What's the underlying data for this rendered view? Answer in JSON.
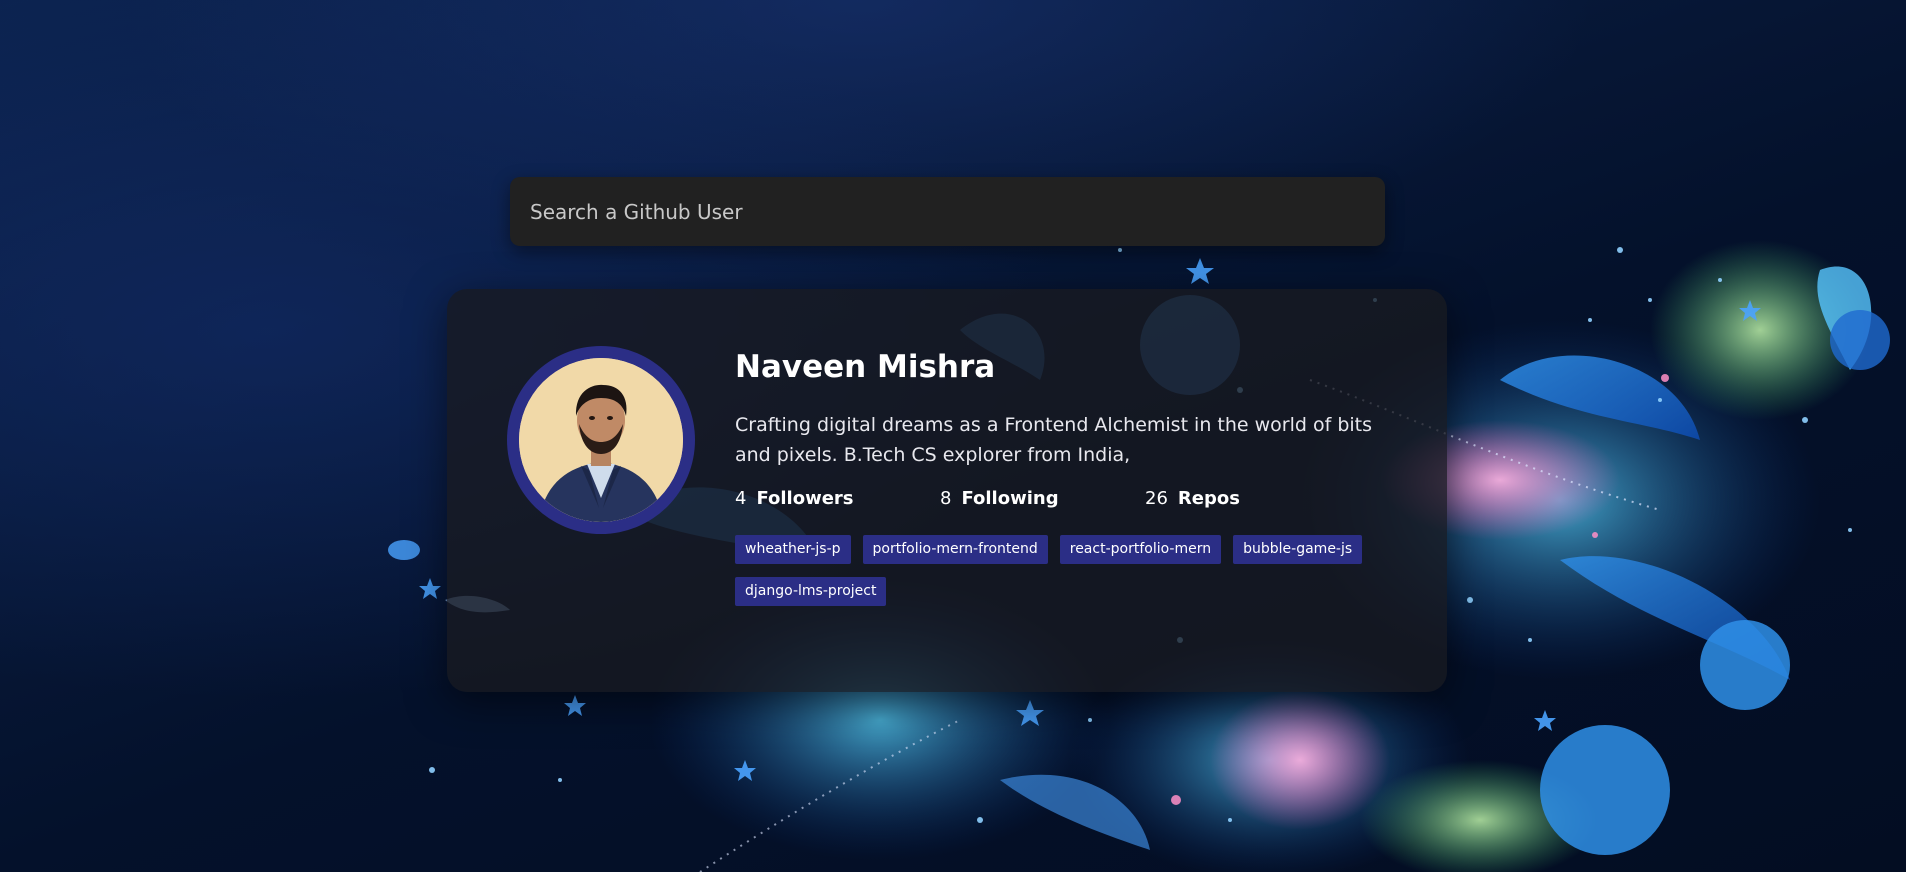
{
  "search": {
    "placeholder": "Search a Github User"
  },
  "profile": {
    "name": "Naveen Mishra",
    "bio": "Crafting digital dreams as a Frontend Alchemist in the world of bits and pixels. B.Tech CS explorer from India,",
    "stats": [
      {
        "value": "4",
        "label": "Followers"
      },
      {
        "value": "8",
        "label": "Following"
      },
      {
        "value": "26",
        "label": "Repos"
      }
    ],
    "repos": [
      "wheather-js-p",
      "portfolio-mern-frontend",
      "react-portfolio-mern",
      "bubble-game-js",
      "django-lms-project"
    ]
  },
  "colors": {
    "card_background": "#181a20",
    "search_background": "#212121",
    "accent": "#2b2e86"
  }
}
